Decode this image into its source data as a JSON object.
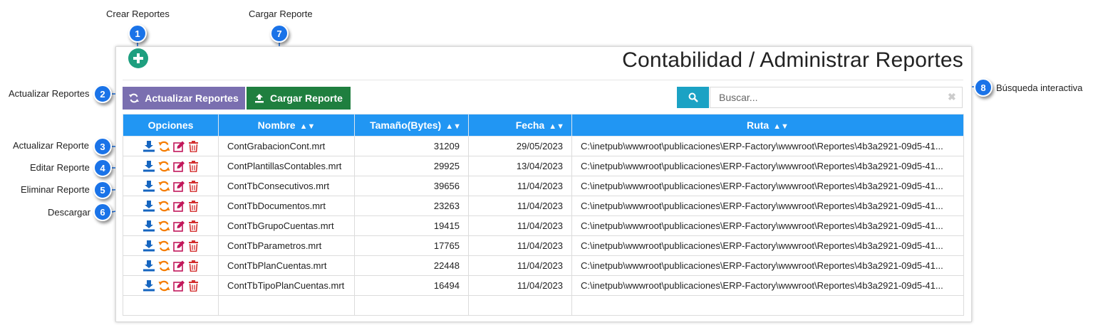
{
  "callouts": [
    {
      "num": "1",
      "label": "Crear Reportes"
    },
    {
      "num": "7",
      "label": "Cargar Reporte"
    },
    {
      "num": "2",
      "label": "Actualizar Reportes"
    },
    {
      "num": "8",
      "label": "Búsqueda interactiva"
    },
    {
      "num": "3",
      "label": "Actualizar Reporte"
    },
    {
      "num": "4",
      "label": "Editar Reporte"
    },
    {
      "num": "5",
      "label": "Eliminar Reporte"
    },
    {
      "num": "6",
      "label": "Descargar"
    }
  ],
  "page": {
    "title": "Contabilidad / Administrar Reportes"
  },
  "toolbar": {
    "refresh_label": "Actualizar Reportes",
    "upload_label": "Cargar Reporte"
  },
  "search": {
    "placeholder": "Buscar...",
    "value": ""
  },
  "table": {
    "headers": {
      "options": "Opciones",
      "name": "Nombre",
      "size": "Tamaño(Bytes)",
      "date": "Fecha",
      "path": "Ruta"
    },
    "rows": [
      {
        "name": "ContGrabacionCont.mrt",
        "size": "31209",
        "date": "29/05/2023",
        "path": "C:\\inetpub\\wwwroot\\publicaciones\\ERP-Factory\\wwwroot\\Reportes\\4b3a2921-09d5-41..."
      },
      {
        "name": "ContPlantillasContables.mrt",
        "size": "29925",
        "date": "13/04/2023",
        "path": "C:\\inetpub\\wwwroot\\publicaciones\\ERP-Factory\\wwwroot\\Reportes\\4b3a2921-09d5-41..."
      },
      {
        "name": "ContTbConsecutivos.mrt",
        "size": "39656",
        "date": "11/04/2023",
        "path": "C:\\inetpub\\wwwroot\\publicaciones\\ERP-Factory\\wwwroot\\Reportes\\4b3a2921-09d5-41..."
      },
      {
        "name": "ContTbDocumentos.mrt",
        "size": "23263",
        "date": "11/04/2023",
        "path": "C:\\inetpub\\wwwroot\\publicaciones\\ERP-Factory\\wwwroot\\Reportes\\4b3a2921-09d5-41..."
      },
      {
        "name": "ContTbGrupoCuentas.mrt",
        "size": "19415",
        "date": "11/04/2023",
        "path": "C:\\inetpub\\wwwroot\\publicaciones\\ERP-Factory\\wwwroot\\Reportes\\4b3a2921-09d5-41..."
      },
      {
        "name": "ContTbParametros.mrt",
        "size": "17765",
        "date": "11/04/2023",
        "path": "C:\\inetpub\\wwwroot\\publicaciones\\ERP-Factory\\wwwroot\\Reportes\\4b3a2921-09d5-41..."
      },
      {
        "name": "ContTbPlanCuentas.mrt",
        "size": "22448",
        "date": "11/04/2023",
        "path": "C:\\inetpub\\wwwroot\\publicaciones\\ERP-Factory\\wwwroot\\Reportes\\4b3a2921-09d5-41..."
      },
      {
        "name": "ContTbTipoPlanCuentas.mrt",
        "size": "16494",
        "date": "11/04/2023",
        "path": "C:\\inetpub\\wwwroot\\publicaciones\\ERP-Factory\\wwwroot\\Reportes\\4b3a2921-09d5-41..."
      }
    ]
  },
  "icons": {
    "add": "plus-circle-icon",
    "refresh": "refresh-icon",
    "upload": "upload-icon",
    "search": "search-icon",
    "clear": "clear-icon",
    "download": "download-icon",
    "edit": "edit-icon",
    "delete": "trash-icon"
  },
  "colors": {
    "accent": "#2196f3",
    "callout": "#1a73e8",
    "refresh_btn": "#7a6fb0",
    "upload_btn": "#1f7f3f",
    "search_btn": "#1ba2c4",
    "add_btn": "#1e9f7f",
    "download": "#1565c0",
    "reload": "#f57c00",
    "edit": "#c2185b",
    "delete": "#d32f2f"
  }
}
